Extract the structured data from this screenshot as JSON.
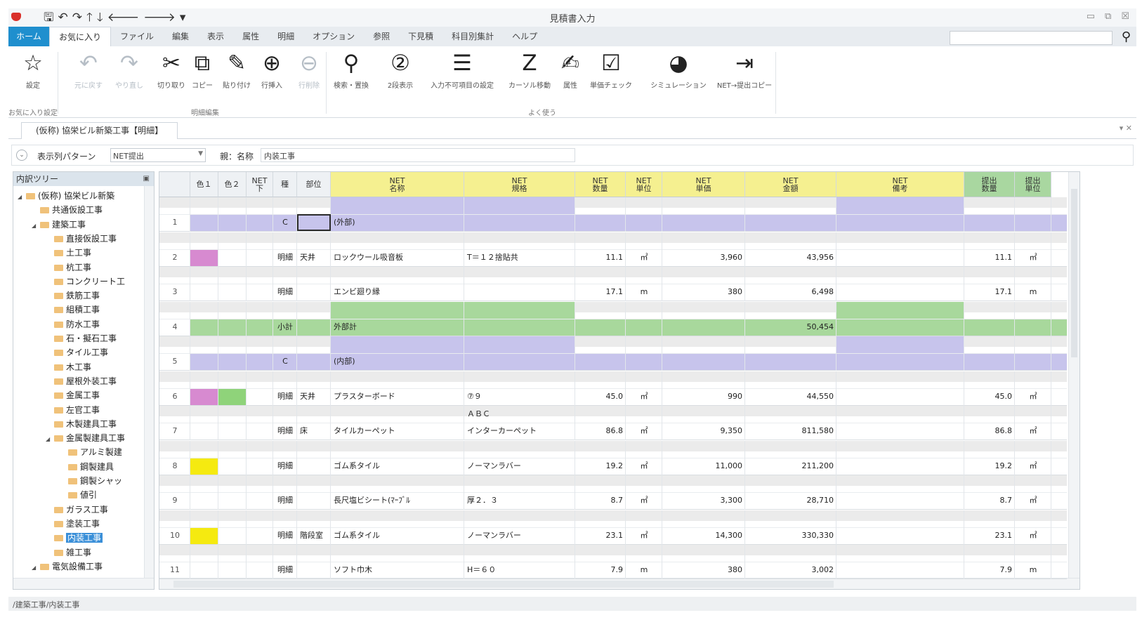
{
  "window": {
    "title": "見積書入力",
    "controls": [
      "▭",
      "⧉",
      "☒"
    ]
  },
  "qat": [
    "🖫",
    "↶",
    "↷",
    "🡑",
    "🡓",
    "🡐",
    "🡒",
    "▾"
  ],
  "menu": {
    "home": "ホーム",
    "tabs": [
      "お気に入り",
      "ファイル",
      "編集",
      "表示",
      "属性",
      "明細",
      "オプション",
      "参照",
      "下見積",
      "科目別集計",
      "ヘルプ"
    ]
  },
  "ribbon": {
    "buttons": [
      {
        "icon": "☆",
        "label": "設定",
        "dis": false
      },
      {
        "icon": "↶",
        "label": "元に戻す",
        "dis": true
      },
      {
        "icon": "↷",
        "label": "やり直し",
        "dis": true
      },
      {
        "icon": "✂",
        "label": "切り取り",
        "dis": false
      },
      {
        "icon": "⧉",
        "label": "コピー",
        "dis": false
      },
      {
        "icon": "✎",
        "label": "貼り付け",
        "dis": false
      },
      {
        "icon": "⊕",
        "label": "行挿入",
        "dis": false
      },
      {
        "icon": "⊖",
        "label": "行削除",
        "dis": true
      },
      {
        "icon": "⚲",
        "label": "検索・置換",
        "dis": false
      },
      {
        "icon": "②",
        "label": "2段表示",
        "dis": false
      },
      {
        "icon": "☰",
        "label": "入力不可項目の設定",
        "dis": false
      },
      {
        "icon": "Z",
        "label": "カーソル移動",
        "dis": false
      },
      {
        "icon": "✍",
        "label": "属性",
        "dis": false
      },
      {
        "icon": "☑",
        "label": "単価チェック",
        "dis": false
      },
      {
        "icon": "◕",
        "label": "シミュレーション",
        "dis": false
      },
      {
        "icon": "⇥",
        "label": "NET→提出コピー",
        "dis": false
      }
    ],
    "groups": [
      "お気に入り設定",
      "明細編集",
      "よく使う"
    ]
  },
  "doctab": {
    "title": "(仮称) 協栄ビル新築工事【明細】",
    "ctl": "▾ ✕"
  },
  "filter": {
    "toggle": "⌄",
    "pattern_label": "表示列パターン",
    "pattern_value": "NET提出",
    "parent_label": "親：名称",
    "parent_value": "内装工事"
  },
  "tree": {
    "title": "内訳ツリー",
    "pin": "▣",
    "items": [
      {
        "t": "(仮称) 協栄ビル新築",
        "d": 0,
        "tg": "◢",
        "sel": false
      },
      {
        "t": "共通仮設工事",
        "d": 1,
        "tg": "",
        "sel": false
      },
      {
        "t": "建築工事",
        "d": 1,
        "tg": "◢",
        "sel": false
      },
      {
        "t": "直接仮設工事",
        "d": 2,
        "tg": "",
        "sel": false
      },
      {
        "t": "土工事",
        "d": 2,
        "tg": "",
        "sel": false
      },
      {
        "t": "杭工事",
        "d": 2,
        "tg": "",
        "sel": false
      },
      {
        "t": "コンクリート工",
        "d": 2,
        "tg": "",
        "sel": false
      },
      {
        "t": "鉄筋工事",
        "d": 2,
        "tg": "",
        "sel": false
      },
      {
        "t": "組積工事",
        "d": 2,
        "tg": "",
        "sel": false
      },
      {
        "t": "防水工事",
        "d": 2,
        "tg": "",
        "sel": false
      },
      {
        "t": "石・擬石工事",
        "d": 2,
        "tg": "",
        "sel": false
      },
      {
        "t": "タイル工事",
        "d": 2,
        "tg": "",
        "sel": false
      },
      {
        "t": "木工事",
        "d": 2,
        "tg": "",
        "sel": false
      },
      {
        "t": "屋根外装工事",
        "d": 2,
        "tg": "",
        "sel": false
      },
      {
        "t": "金属工事",
        "d": 2,
        "tg": "",
        "sel": false
      },
      {
        "t": "左官工事",
        "d": 2,
        "tg": "",
        "sel": false
      },
      {
        "t": "木製建具工事",
        "d": 2,
        "tg": "",
        "sel": false
      },
      {
        "t": "金属製建具工事",
        "d": 2,
        "tg": "◢",
        "sel": false
      },
      {
        "t": "アルミ製建",
        "d": 3,
        "tg": "",
        "sel": false
      },
      {
        "t": "鋼製建具",
        "d": 3,
        "tg": "",
        "sel": false
      },
      {
        "t": "鋼製シャッ",
        "d": 3,
        "tg": "",
        "sel": false
      },
      {
        "t": "値引",
        "d": 3,
        "tg": "",
        "sel": false
      },
      {
        "t": "ガラス工事",
        "d": 2,
        "tg": "",
        "sel": false
      },
      {
        "t": "塗装工事",
        "d": 2,
        "tg": "",
        "sel": false
      },
      {
        "t": "内装工事",
        "d": 2,
        "tg": "",
        "sel": true
      },
      {
        "t": "雑工事",
        "d": 2,
        "tg": "",
        "sel": false
      },
      {
        "t": "電気設備工事",
        "d": 1,
        "tg": "◢",
        "sel": false
      }
    ]
  },
  "colors": {
    "purple": "#c7c4ec",
    "green": "#a8d89c",
    "pink": "#d78ad0",
    "lime": "#8fd37a",
    "yellow": "#f5ea10"
  },
  "grid": {
    "columns": [
      {
        "k": "rn",
        "h": "",
        "w": 44
      },
      {
        "k": "c1",
        "h": "色１",
        "w": 40
      },
      {
        "k": "c2",
        "h": "色２",
        "w": 40
      },
      {
        "k": "net",
        "h": "NET\n下",
        "w": 38
      },
      {
        "k": "kind",
        "h": "種",
        "w": 34
      },
      {
        "k": "part",
        "h": "部位",
        "w": 48
      },
      {
        "k": "name",
        "h": "NET\n名称",
        "w": 190,
        "y": true
      },
      {
        "k": "spec",
        "h": "NET\n規格",
        "w": 158,
        "y": true
      },
      {
        "k": "qty",
        "h": "NET\n数量",
        "w": 72,
        "y": true
      },
      {
        "k": "unit",
        "h": "NET\n単位",
        "w": 52,
        "y": true
      },
      {
        "k": "price",
        "h": "NET\n単価",
        "w": 118,
        "y": true
      },
      {
        "k": "amt",
        "h": "NET\n金額",
        "w": 130,
        "y": true
      },
      {
        "k": "note",
        "h": "NET\n備考",
        "w": 182,
        "y": true
      },
      {
        "k": "sqty",
        "h": "提出\n数量",
        "w": 72,
        "g": true
      },
      {
        "k": "sunit",
        "h": "提出\n単位",
        "w": 52,
        "g": true
      }
    ],
    "rows": [
      {
        "rn": "1",
        "kind": "C",
        "name": "(外部)",
        "band": "purple",
        "c1": "",
        "c2": ""
      },
      {
        "rn": "2",
        "kind": "明細",
        "part": "天井",
        "name": "ロックウール吸音板",
        "spec": "T＝１２捨貼共",
        "qty": "11.1",
        "unit": "㎡",
        "price": "3,960",
        "amt": "43,956",
        "sqty": "11.1",
        "sunit": "㎡",
        "c1": "pink",
        "c2": ""
      },
      {
        "rn": "3",
        "kind": "明細",
        "name": "エンビ廻り縁",
        "qty": "17.1",
        "unit": "m",
        "price": "380",
        "amt": "6,498",
        "sqty": "17.1",
        "sunit": "m",
        "c1": "",
        "c2": ""
      },
      {
        "rn": "4",
        "kind": "小計",
        "name": "外部計",
        "amt": "50,454",
        "band": "green",
        "c1": "",
        "c2": ""
      },
      {
        "rn": "5",
        "kind": "C",
        "name": "(内部)",
        "band": "purple",
        "c1": "",
        "c2": ""
      },
      {
        "rn": "6",
        "kind": "明細",
        "part": "天井",
        "name": "プラスターボード",
        "spec": "⑦９",
        "qty": "45.0",
        "unit": "㎡",
        "price": "990",
        "amt": "44,550",
        "sqty": "45.0",
        "sunit": "㎡",
        "c1": "pink",
        "c2": "lime"
      },
      {
        "rn": "7",
        "kind": "明細",
        "part": "床",
        "name": "タイルカーペット",
        "spec": "インターカーペット",
        "spec0": "ＡＢＣ",
        "qty": "86.8",
        "unit": "㎡",
        "price": "9,350",
        "amt": "811,580",
        "sqty": "86.8",
        "sunit": "㎡",
        "c1": "",
        "c2": ""
      },
      {
        "rn": "8",
        "kind": "明細",
        "name": "ゴム系タイル",
        "spec": "ノーマンラバー",
        "qty": "19.2",
        "unit": "㎡",
        "price": "11,000",
        "amt": "211,200",
        "sqty": "19.2",
        "sunit": "㎡",
        "c1": "yellow",
        "c2": ""
      },
      {
        "rn": "9",
        "kind": "明細",
        "name": "長尺塩ビシート(ﾏｰﾌﾞﾙ",
        "spec": "厚２．３",
        "qty": "8.7",
        "unit": "㎡",
        "price": "3,300",
        "amt": "28,710",
        "sqty": "8.7",
        "sunit": "㎡",
        "c1": "",
        "c2": ""
      },
      {
        "rn": "10",
        "kind": "明細",
        "part": "階段室",
        "name": "ゴム系タイル",
        "spec": "ノーマンラバー",
        "qty": "23.1",
        "unit": "㎡",
        "price": "14,300",
        "amt": "330,330",
        "sqty": "23.1",
        "sunit": "㎡",
        "c1": "yellow",
        "c2": ""
      },
      {
        "rn": "11",
        "kind": "明細",
        "name": "ソフト巾木",
        "spec": "H＝６０",
        "qty": "7.9",
        "unit": "m",
        "price": "380",
        "amt": "3,002",
        "sqty": "7.9",
        "sunit": "m",
        "c1": "",
        "c2": ""
      }
    ]
  },
  "status": {
    "path": "/建築工事/内装工事"
  }
}
